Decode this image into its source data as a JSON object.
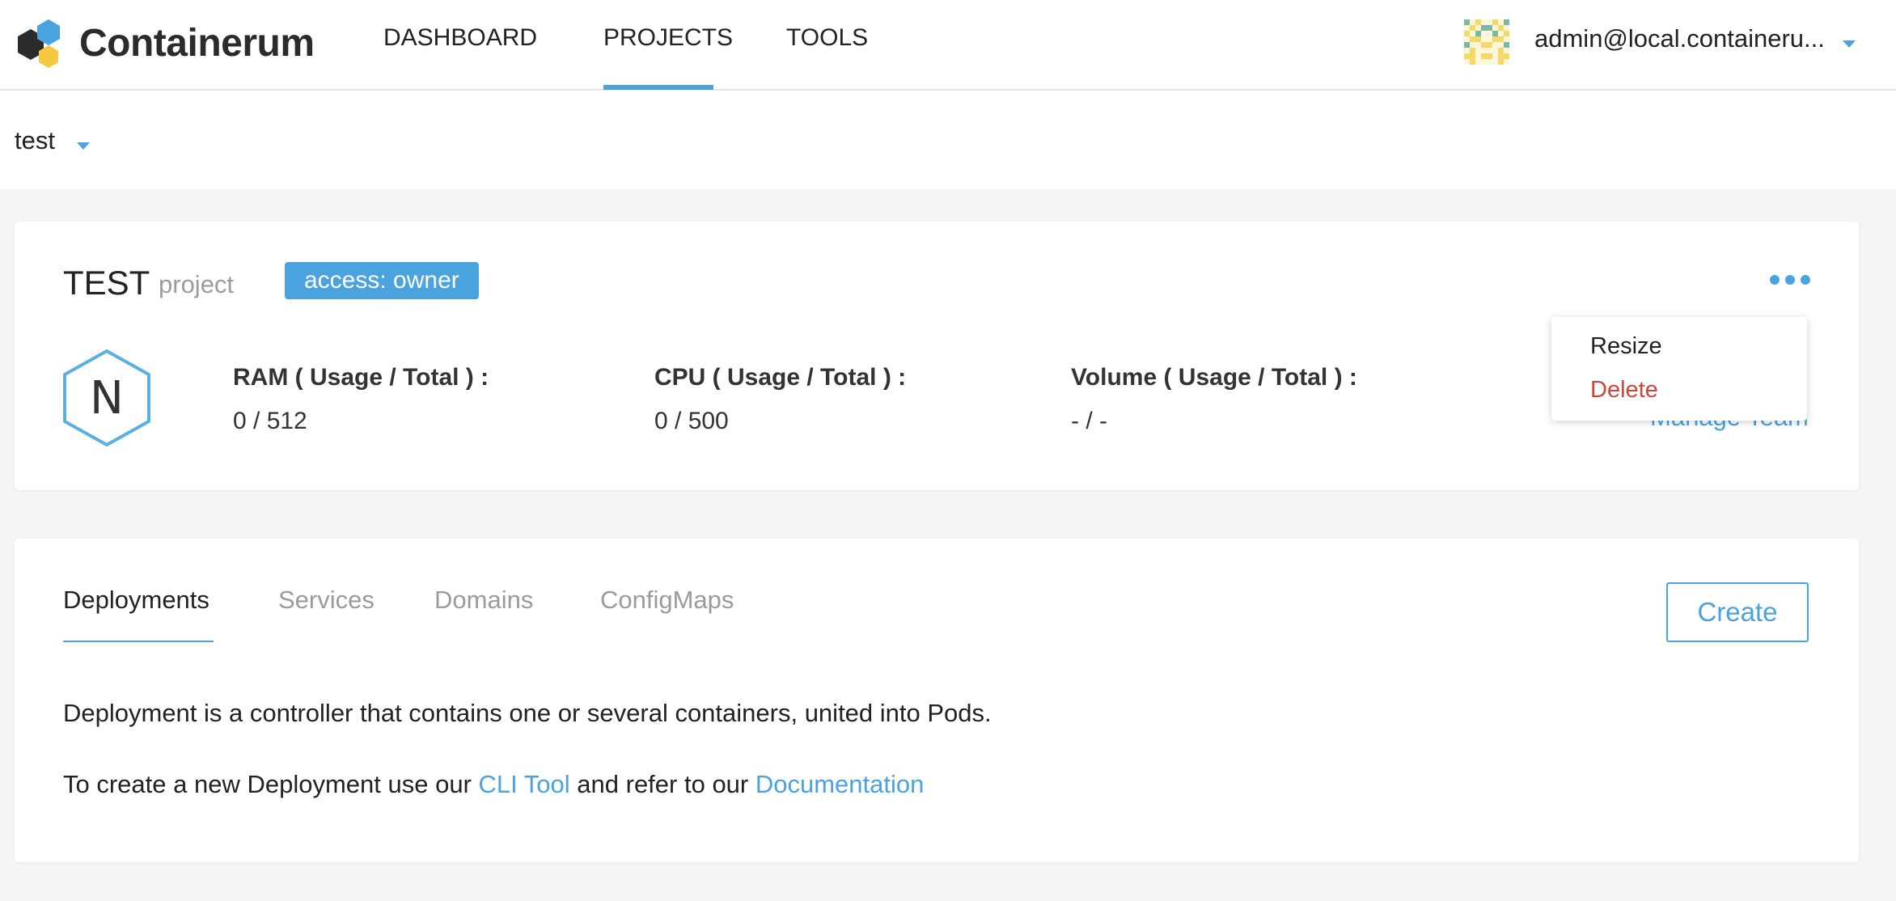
{
  "app": {
    "brand": "Containerum"
  },
  "nav": {
    "dashboard": "DASHBOARD",
    "projects": "PROJECTS",
    "tools": "TOOLS"
  },
  "user": {
    "email": "admin@local.containeru..."
  },
  "project_selector": {
    "value": "test"
  },
  "project": {
    "title": "TEST",
    "kind": "project",
    "access_badge": "access: owner",
    "avatar_letter": "N",
    "metrics": [
      {
        "label": "RAM ( Usage / Total ) :",
        "value": "0 / 512"
      },
      {
        "label": "CPU ( Usage / Total ) :",
        "value": "0 / 500"
      },
      {
        "label": "Volume ( Usage / Total ) :",
        "value": "- / -"
      }
    ],
    "manage_team": "Manage Team",
    "menu": {
      "resize": "Resize",
      "delete": "Delete"
    }
  },
  "tabs": {
    "deployments": "Deployments",
    "services": "Services",
    "domains": "Domains",
    "configmaps": "ConfigMaps",
    "active": "Deployments"
  },
  "create_button": "Create",
  "content": {
    "line1": "Deployment is a controller that contains one or several containers, united into Pods.",
    "line2_prefix": "To create a new Deployment use our ",
    "cli_link": "CLI Tool",
    "line2_middle": " and refer to our ",
    "docs_link": "Documentation"
  },
  "colors": {
    "accent": "#4aa3df",
    "danger": "#c9473b",
    "logo_dark": "#2b2b2b",
    "logo_blue": "#4aa3df",
    "logo_yellow": "#f5c842"
  }
}
